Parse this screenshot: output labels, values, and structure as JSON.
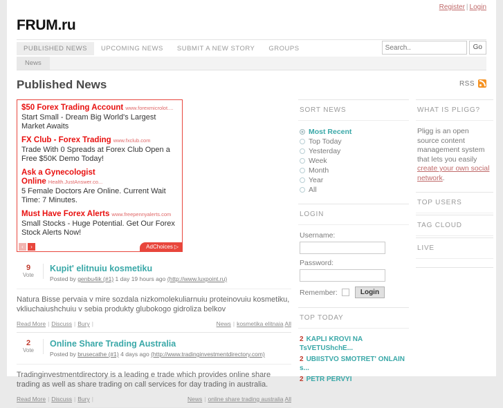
{
  "header": {
    "register_label": "Register",
    "separator": "|",
    "login_label": "Login",
    "brand": "FRUM.ru"
  },
  "nav": {
    "items": [
      {
        "label": "PUBLISHED NEWS",
        "active": true
      },
      {
        "label": "UPCOMING NEWS",
        "active": false
      },
      {
        "label": "SUBMIT A NEW STORY",
        "active": false
      },
      {
        "label": "GROUPS",
        "active": false
      }
    ],
    "subtab": "News"
  },
  "search": {
    "value": "",
    "placeholder": "Search..",
    "go_label": "Go"
  },
  "main": {
    "page_title": "Published News",
    "rss_label": "RSS"
  },
  "ads": [
    {
      "title": "$50 Forex Trading Account",
      "url": "www.forexmicrolot....",
      "body": "Start Small - Dream Big World's Largest Market Awaits"
    },
    {
      "title": "FX Club - Forex Trading",
      "url": "www.fxclub.com",
      "body": "Trade With 0 Spreads at Forex Club Open a Free $50K Demo Today!"
    },
    {
      "title": "Ask a Gynecologist Online",
      "url": "Health.JustAnswer.co...",
      "body": "5 Female Doctors Are Online. Current Wait Time: 7 Minutes."
    },
    {
      "title": "Must Have Forex Alerts",
      "url": "www.freepennyalerts.com",
      "body": "Small Stocks - Huge Potential. Get Our Forex Stock Alerts Now!"
    }
  ],
  "ad_controls": {
    "prev": "‹",
    "next": "›",
    "adchoices_label": "AdChoices",
    "adchoices_mark": "▷"
  },
  "stories": [
    {
      "votes": "9",
      "vote_label": "Vote",
      "title": "Kupit' elitnuiu kosmetiku",
      "posted_by_prefix": "Posted by",
      "author": "genbu4ik (#1)",
      "time": "1 day 19 hours ago",
      "source": "(http://www.luxpoint.ru)",
      "body": "Natura Bisse pervaia v mire sozdala nizkomolekuliarnuiu proteinovuiu kosmetiku, vkliuchaiushchuiu v sebia produkty glubokogo gidroliza belkov",
      "read_more": "Read More",
      "discuss": "Discuss",
      "bury": "Bury",
      "category": "News",
      "tag": "kosmetika elitnaia",
      "all": "All"
    },
    {
      "votes": "2",
      "vote_label": "Vote",
      "title": "Online Share Trading Australia",
      "posted_by_prefix": "Posted by",
      "author": "brusecathe (#1)",
      "time": "4 days ago",
      "source": "(http://www.tradinginvestmentdirectory.com)",
      "body": "Tradinginvestmentdirectory is a leading e trade which provides online share trading as well as share trading on call services for day trading in australia.",
      "read_more": "Read More",
      "discuss": "Discuss",
      "bury": "Bury",
      "category": "News",
      "tag": "online share trading australia",
      "all": "All"
    }
  ],
  "sort_news": {
    "title": "SORT NEWS",
    "options": [
      {
        "label": "Most Recent",
        "selected": true
      },
      {
        "label": "Top Today",
        "selected": false
      },
      {
        "label": "Yesterday",
        "selected": false
      },
      {
        "label": "Week",
        "selected": false
      },
      {
        "label": "Month",
        "selected": false
      },
      {
        "label": "Year",
        "selected": false
      },
      {
        "label": "All",
        "selected": false
      }
    ]
  },
  "login_widget": {
    "title": "LOGIN",
    "username_label": "Username:",
    "username_value": "",
    "password_label": "Password:",
    "password_value": "",
    "remember_label": "Remember:",
    "login_button": "Login"
  },
  "top_today": {
    "title": "TOP TODAY",
    "items": [
      {
        "count": "2",
        "label": "KAPLI KROVI NA TsVETUShchE..."
      },
      {
        "count": "2",
        "label": "UBIISTVO SMOTRET' ONLAIN s..."
      },
      {
        "count": "2",
        "label": "PETR PERVYI"
      }
    ]
  },
  "what_is_pligg": {
    "title": "WHAT IS PLIGG?",
    "text_before": "Pligg is an open source content management system that lets you easily ",
    "link_text": "create your own social network",
    "text_after": "."
  },
  "right_widgets": [
    {
      "title": "TOP USERS"
    },
    {
      "title": "TAG CLOUD"
    },
    {
      "title": "LIVE"
    }
  ],
  "colors": {
    "accent_teal": "#3aa8a8",
    "ad_red": "#e8463c",
    "vote_red": "#c0392b",
    "link_red": "#c06a6a",
    "rss_orange": "#f59324"
  }
}
